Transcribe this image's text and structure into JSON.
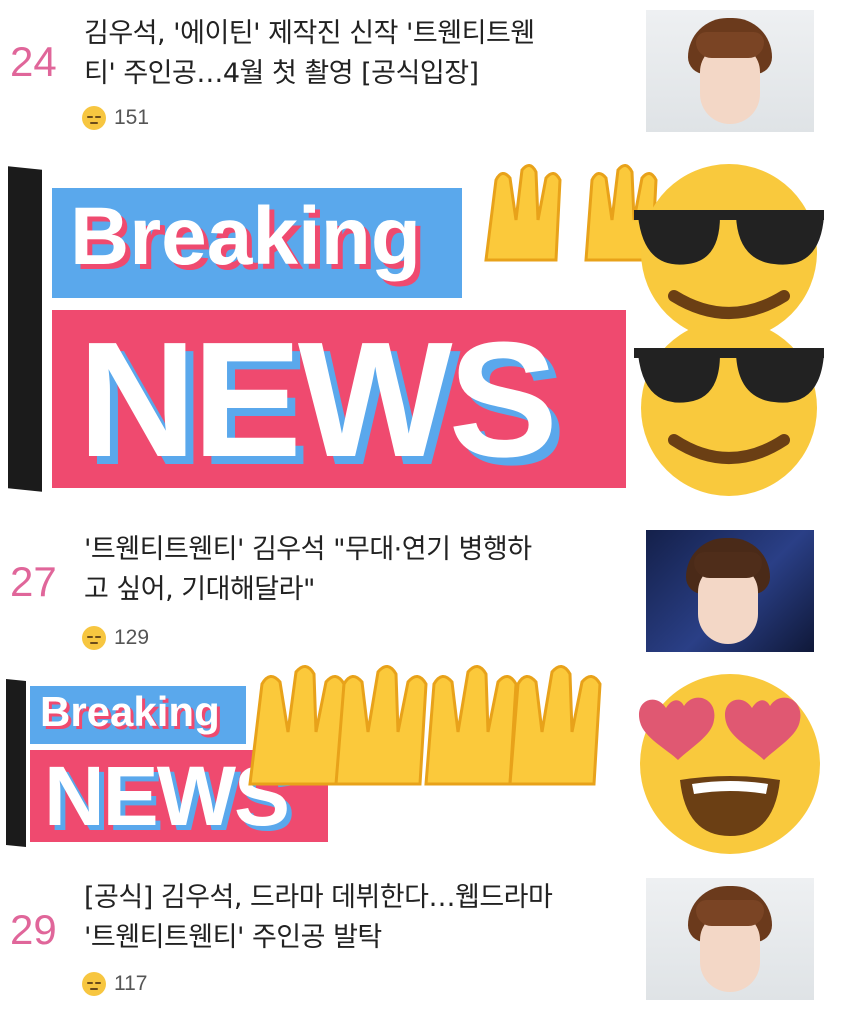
{
  "articles": [
    {
      "rank": "24",
      "line1": "김우석, '에이틴' 제작진 신작 '트웬티트웬",
      "line2": "티' 주인공…4월 첫 촬영 [공식입장]",
      "count": "151"
    },
    {
      "rank": "27",
      "line1": "'트웬티트웬티' 김우석 \"무대·연기 병행하",
      "line2": "고 싶어, 기대해달라\"",
      "count": "129"
    },
    {
      "rank": "29",
      "line1": "[공식] 김우석, 드라마 데뷔한다…웹드라마",
      "line2": "'트웬티트웬티' 주인공 발탁",
      "count": "117"
    }
  ],
  "overlay": {
    "breaking_label": "Breaking",
    "news_label": "NEWS"
  },
  "colors": {
    "rank": "#e0669a",
    "breaking_blue": "#5aa8ec",
    "news_red": "#ef4a6f"
  },
  "icons": [
    "pensive-emoji",
    "sunglasses-emoji",
    "raising-hands-emoji",
    "heart-eyes-emoji"
  ]
}
